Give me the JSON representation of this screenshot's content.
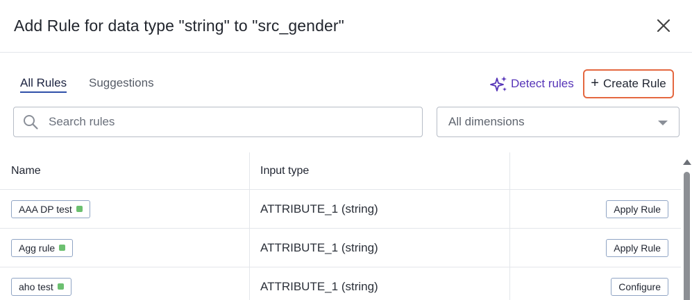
{
  "dialog": {
    "title": "Add Rule for data type \"string\" to \"src_gender\""
  },
  "tabs": [
    {
      "label": "All Rules",
      "active": true
    },
    {
      "label": "Suggestions",
      "active": false
    }
  ],
  "actions": {
    "detect_label": "Detect rules",
    "create_label": "Create Rule"
  },
  "search": {
    "placeholder": "Search rules",
    "value": ""
  },
  "dimension_filter": {
    "selected": "All dimensions"
  },
  "table": {
    "columns": [
      "Name",
      "Input type",
      ""
    ],
    "rows": [
      {
        "name": "AAA DP test",
        "input_type": "ATTRIBUTE_1 (string)",
        "action": "Apply Rule"
      },
      {
        "name": "Agg rule",
        "input_type": "ATTRIBUTE_1 (string)",
        "action": "Apply Rule"
      },
      {
        "name": "aho test",
        "input_type": "ATTRIBUTE_1 (string)",
        "action": "Configure"
      }
    ]
  },
  "colors": {
    "accent_purple": "#5634b8",
    "create_border": "#e4673f",
    "tab_underline": "#2e4fa8",
    "status_dot": "#6cc070"
  },
  "icons": {
    "close": "close-icon",
    "detect": "sparkle-icon",
    "create": "plus-icon",
    "search": "search-icon",
    "dropdown": "chevron-down-icon"
  }
}
